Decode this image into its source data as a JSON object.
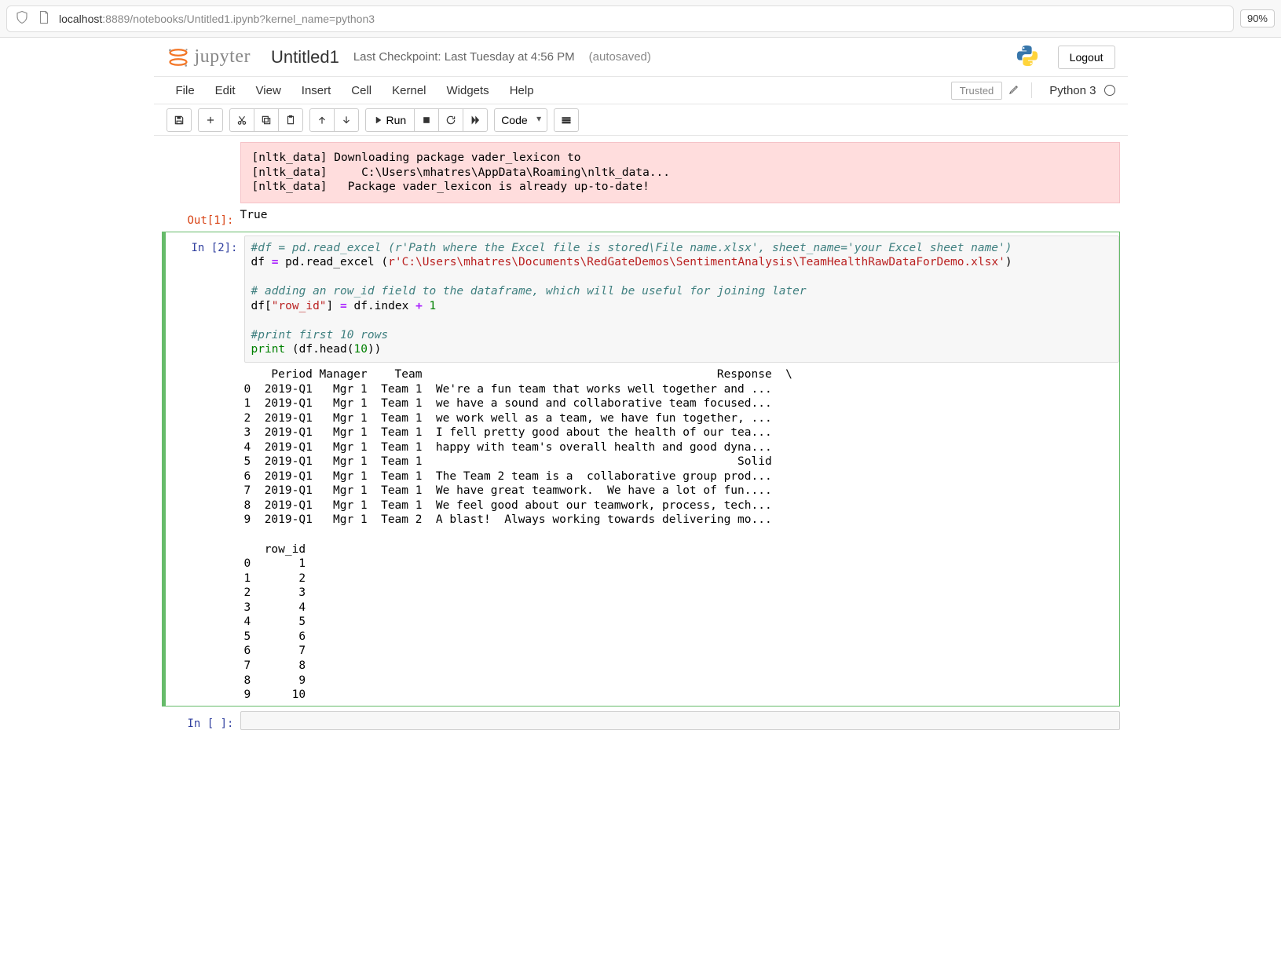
{
  "urlbar": {
    "host": "localhost",
    "path": ":8889/notebooks/Untitled1.ipynb?kernel_name=python3",
    "zoom": "90%"
  },
  "header": {
    "logo_text": "jupyter",
    "title": "Untitled1",
    "checkpoint": "Last Checkpoint: Last Tuesday at 4:56 PM",
    "autosave": "(autosaved)",
    "logout": "Logout"
  },
  "menubar": {
    "items": [
      "File",
      "Edit",
      "View",
      "Insert",
      "Cell",
      "Kernel",
      "Widgets",
      "Help"
    ],
    "trusted": "Trusted",
    "kernel": "Python 3"
  },
  "toolbar": {
    "run": "Run",
    "celltype": "Code"
  },
  "cells": {
    "stderr_lines": "[nltk_data] Downloading package vader_lexicon to\n[nltk_data]     C:\\Users\\mhatres\\AppData\\Roaming\\nltk_data...\n[nltk_data]   Package vader_lexicon is already up-to-date!",
    "out1_prompt": "Out[1]:",
    "out1_value": "True",
    "in2_prompt": "In [2]:",
    "in2_code": {
      "l1": "#df = pd.read_excel (r'Path where the Excel file is stored\\File name.xlsx', sheet_name='your Excel sheet name')",
      "l2a": "df ",
      "l2b": "=",
      "l2c": " pd.read_excel (",
      "l2d": "r'C:\\Users\\mhatres\\Documents\\RedGateDemos\\SentimentAnalysis\\TeamHealthRawDataForDemo.xlsx'",
      "l2e": ")",
      "l3": "",
      "l4": "# adding an row_id field to the dataframe, which will be useful for joining later",
      "l5a": "df[",
      "l5b": "\"row_id\"",
      "l5c": "] ",
      "l5d": "=",
      "l5e": " df.index ",
      "l5f": "+",
      "l5g": " ",
      "l5h": "1",
      "l6": "",
      "l7": "#print first 10 rows",
      "l8a": "print",
      "l8b": " (df.head(",
      "l8c": "10",
      "l8d": "))"
    },
    "in2_output": "    Period Manager    Team                                           Response  \\\n0  2019-Q1   Mgr 1  Team 1  We're a fun team that works well together and ...   \n1  2019-Q1   Mgr 1  Team 1  we have a sound and collaborative team focused...   \n2  2019-Q1   Mgr 1  Team 1  we work well as a team, we have fun together, ...   \n3  2019-Q1   Mgr 1  Team 1  I fell pretty good about the health of our tea...   \n4  2019-Q1   Mgr 1  Team 1  happy with team's overall health and good dyna...   \n5  2019-Q1   Mgr 1  Team 1                                              Solid   \n6  2019-Q1   Mgr 1  Team 1  The Team 2 team is a  collaborative group prod...   \n7  2019-Q1   Mgr 1  Team 1  We have great teamwork.  We have a lot of fun....   \n8  2019-Q1   Mgr 1  Team 1  We feel good about our teamwork, process, tech...   \n9  2019-Q1   Mgr 1  Team 2  A blast!  Always working towards delivering mo...   \n\n   row_id  \n0       1  \n1       2  \n2       3  \n3       4  \n4       5  \n5       6  \n6       7  \n7       8  \n8       9  \n9      10  ",
    "in3_prompt": "In [ ]:"
  }
}
